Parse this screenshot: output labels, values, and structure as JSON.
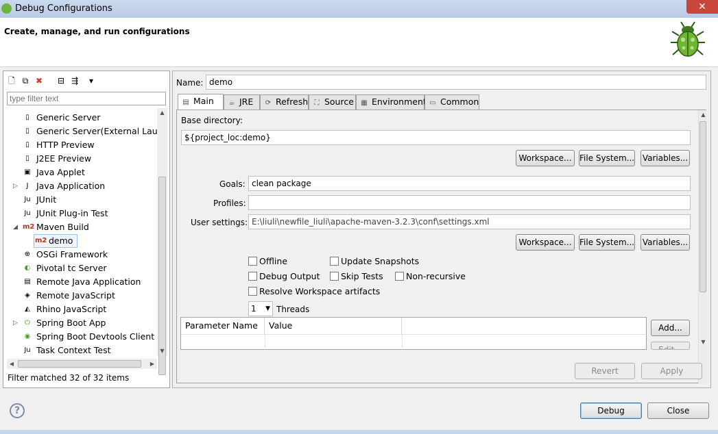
{
  "window": {
    "title": "Debug Configurations",
    "close_label": "✕"
  },
  "header": {
    "title": "Create, manage, and run configurations"
  },
  "left": {
    "toolbar": [
      {
        "name": "new-config-icon",
        "glyph": "🗋"
      },
      {
        "name": "duplicate-icon",
        "glyph": "⧉"
      },
      {
        "name": "delete-icon",
        "glyph": "✖"
      },
      {
        "name": "collapse-all-icon",
        "glyph": "⊟"
      },
      {
        "name": "filter-icon",
        "glyph": "⇶"
      },
      {
        "name": "view-menu-icon",
        "glyph": "▾"
      }
    ],
    "filter_placeholder": "type filter text",
    "tree": [
      {
        "label": "Generic Server",
        "icon": "server-icon",
        "glyph": "▯",
        "indent": 1
      },
      {
        "label": "Generic Server(External Launc",
        "icon": "server-icon",
        "glyph": "▯",
        "indent": 1
      },
      {
        "label": "HTTP Preview",
        "icon": "server-icon",
        "glyph": "▯",
        "indent": 1
      },
      {
        "label": "J2EE Preview",
        "icon": "server-icon",
        "glyph": "▯",
        "indent": 1
      },
      {
        "label": "Java Applet",
        "icon": "applet-icon",
        "glyph": "▣",
        "indent": 1
      },
      {
        "label": "Java Application",
        "icon": "java-app-icon",
        "glyph": "J",
        "indent": 1,
        "twisty": "▷"
      },
      {
        "label": "JUnit",
        "icon": "junit-icon",
        "glyph": "Ju",
        "indent": 1
      },
      {
        "label": "JUnit Plug-in Test",
        "icon": "junit-plugin-icon",
        "glyph": "Ju",
        "indent": 1
      },
      {
        "label": "Maven Build",
        "icon": "maven-icon",
        "glyph": "m2",
        "indent": 1,
        "twisty": "◢"
      },
      {
        "label": "demo",
        "icon": "maven-icon",
        "glyph": "m2",
        "indent": 2,
        "selected": true
      },
      {
        "label": "OSGi Framework",
        "icon": "osgi-icon",
        "glyph": "⊕",
        "indent": 1
      },
      {
        "label": "Pivotal tc Server",
        "icon": "tc-server-icon",
        "glyph": "◐",
        "indent": 1
      },
      {
        "label": "Remote Java Application",
        "icon": "remote-java-icon",
        "glyph": "▤",
        "indent": 1
      },
      {
        "label": "Remote JavaScript",
        "icon": "remote-js-icon",
        "glyph": "◈",
        "indent": 1
      },
      {
        "label": "Rhino JavaScript",
        "icon": "rhino-icon",
        "glyph": "◭",
        "indent": 1
      },
      {
        "label": "Spring Boot App",
        "icon": "spring-boot-icon",
        "glyph": "⏻",
        "indent": 1,
        "twisty": "▷"
      },
      {
        "label": "Spring Boot Devtools Client",
        "icon": "spring-devtools-icon",
        "glyph": "◉",
        "indent": 1
      },
      {
        "label": "Task Context Test",
        "icon": "task-context-icon",
        "glyph": "Ju",
        "indent": 1
      }
    ],
    "status": "Filter matched 32 of 32 items"
  },
  "right": {
    "name_label": "Name:",
    "name_value": "demo",
    "tabs": [
      {
        "label": "Main",
        "icon": "main-tab-icon",
        "glyph": "▤",
        "active": true
      },
      {
        "label": "JRE",
        "icon": "jre-tab-icon",
        "glyph": "☕"
      },
      {
        "label": "Refresh",
        "icon": "refresh-tab-icon",
        "glyph": "⟳"
      },
      {
        "label": "Source",
        "icon": "source-tab-icon",
        "glyph": "⛶"
      },
      {
        "label": "Environment",
        "icon": "environment-tab-icon",
        "glyph": "▦"
      },
      {
        "label": "Common",
        "icon": "common-tab-icon",
        "glyph": "▭"
      }
    ],
    "base_dir_label": "Base directory:",
    "base_dir_value": "${project_loc:demo}",
    "workspace_btn": "Workspace...",
    "filesystem_btn": "File System...",
    "variables_btn": "Variables...",
    "goals_label": "Goals:",
    "goals_value": "clean package",
    "profiles_label": "Profiles:",
    "profiles_value": "",
    "settings_label": "User settings:",
    "settings_value": "E:\\liuli\\newfile_liuli\\apache-maven-3.2.3\\conf\\settings.xml",
    "checkboxes": {
      "offline": "Offline",
      "update_snapshots": "Update Snapshots",
      "debug_output": "Debug Output",
      "skip_tests": "Skip Tests",
      "non_recursive": "Non-recursive",
      "resolve_workspace": "Resolve Workspace artifacts"
    },
    "threads_value": "1",
    "threads_label": "Threads",
    "table_headers": [
      "Parameter Name",
      "Value"
    ],
    "add_btn": "Add...",
    "edit_btn": "Edit...",
    "revert_btn": "Revert",
    "apply_btn": "Apply"
  },
  "footer": {
    "help": "?",
    "debug_btn": "Debug",
    "close_btn": "Close"
  }
}
